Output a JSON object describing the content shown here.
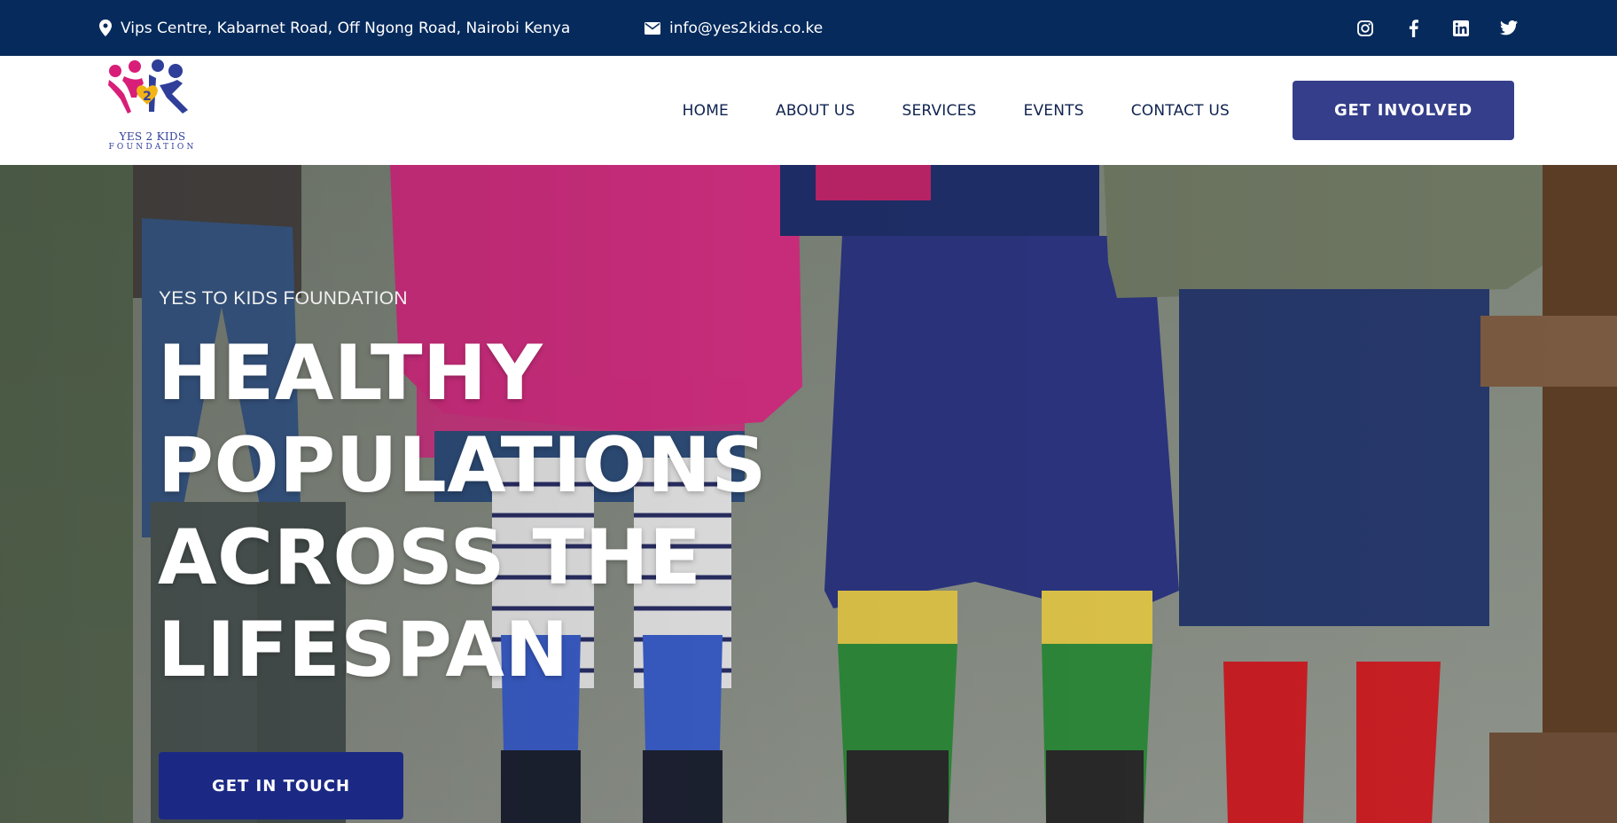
{
  "topbar": {
    "address": "Vips Centre, Kabarnet Road, Off Ngong Road, Nairobi Kenya",
    "email": "info@yes2kids.co.ke",
    "social": [
      {
        "name": "instagram",
        "icon": "instagram-icon"
      },
      {
        "name": "facebook",
        "icon": "facebook-icon"
      },
      {
        "name": "linkedin",
        "icon": "linkedin-icon"
      },
      {
        "name": "twitter",
        "icon": "twitter-icon"
      }
    ]
  },
  "logo": {
    "line1": "YES 2 KIDS",
    "line2": "FOUNDATION",
    "badge": "2",
    "colors": {
      "magenta": "#d81e78",
      "navy": "#2f3f99",
      "yellow": "#f2b317"
    }
  },
  "nav": {
    "items": [
      "HOME",
      "ABOUT US",
      "SERVICES",
      "EVENTS",
      "CONTACT US"
    ],
    "cta": "GET INVOLVED"
  },
  "hero": {
    "eyebrow": "YES TO KIDS FOUNDATION",
    "headline": [
      "HEALTHY",
      "POPULATIONS",
      "ACROSS THE",
      "LIFESPAN"
    ],
    "cta": "GET IN TOUCH"
  },
  "colors": {
    "topbar": "#062a5c",
    "button": "#353e8a",
    "hero_button": "#1b2985",
    "nav_text": "#0f2350"
  }
}
